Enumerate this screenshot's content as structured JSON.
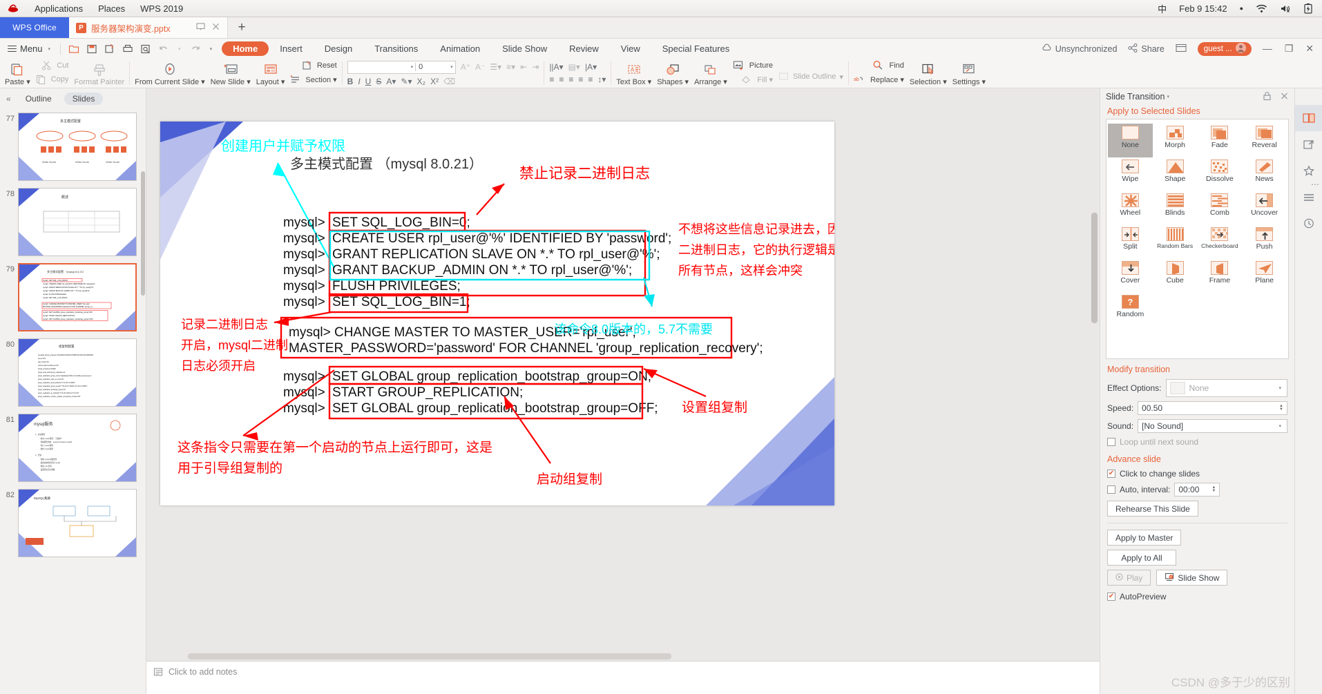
{
  "desktop": {
    "applications": "Applications",
    "places": "Places",
    "app_name": "WPS 2019",
    "input_method": "中",
    "clock": "Feb 9  15:42",
    "tray": [
      "wifi-icon",
      "volume-muted-icon",
      "battery-charging-icon"
    ]
  },
  "tabstrip": {
    "brand": "WPS Office",
    "document_tab": "服务器架构演变.pptx",
    "doc_icon": "P",
    "new_tab": "+",
    "window_controls": [
      "minimize",
      "restore",
      "close"
    ]
  },
  "ribbon": {
    "menu": "Menu",
    "quick_access": [
      "open-icon",
      "save-icon",
      "save-as-icon",
      "print-icon",
      "print-preview-icon",
      "undo-icon",
      "redo-icon",
      "customize-qat-icon"
    ],
    "tabs": [
      "Home",
      "Insert",
      "Design",
      "Transitions",
      "Animation",
      "Slide Show",
      "Review",
      "View",
      "Special Features"
    ],
    "active_tab": "Home",
    "sync_status": "Unsynchronized",
    "share": "Share",
    "account": "guest ...",
    "groups": {
      "clipboard": [
        "Paste",
        "Cut",
        "Copy",
        "Format Painter"
      ],
      "presentation": [
        "From Current Slide",
        "New Slide",
        "Layout",
        "Section",
        "Reset"
      ],
      "font_size_value": "0",
      "font_name_value": "",
      "text": [
        "Text Box",
        "Shapes",
        "Arrange",
        "Picture",
        "Fill",
        "Slide Outline"
      ],
      "editing": [
        "Find",
        "Replace",
        "Selection",
        "Settings"
      ]
    }
  },
  "leftpane": {
    "collapse_icon": "«",
    "tabs": [
      "Outline",
      "Slides"
    ],
    "active_tab": "Slides",
    "thumbnails": [
      {
        "number": "77",
        "title": "多主模式配置"
      },
      {
        "number": "78",
        "title": "概述"
      },
      {
        "number": "79",
        "title": "多主模式配置  mysql 8.0.21"
      },
      {
        "number": "80",
        "title": "组复制配置"
      },
      {
        "number": "81",
        "title": "mysql服务"
      },
      {
        "number": "82",
        "title": "MySQL集群"
      }
    ],
    "selected": "79"
  },
  "notes": {
    "placeholder": "Click to add notes",
    "icon": "notes-icon"
  },
  "slide": {
    "annotations": {
      "cyan_title": "创建用户并赋予权限",
      "heading": "多主模式配置 （mysql 8.0.21）",
      "red_top": "禁止记录二进制日志",
      "red_right_l1": "不想将这些信息记录进去，因为一旦记入",
      "red_right_l2": "二进制日志，它的执行逻辑是发送到其他",
      "red_right_l3": "所有节点，这样会冲突",
      "red_left_l1": "记录二进制日志",
      "red_left_l2": "开启，mysql二进制",
      "red_left_l3": "日志必须开启",
      "cyan_note": "该命令8.0版本的，5.7不需要",
      "red_setrep": "设置组复制",
      "red_bottom_l1": "这条指令只需要在第一个启动的节点上运行即可，这是",
      "red_bottom_l2": "用于引导组复制的",
      "red_startrep": "启动组复制"
    },
    "prompt": "mysql>",
    "commands": [
      "SET SQL_LOG_BIN=0;",
      "CREATE USER rpl_user@'%' IDENTIFIED BY 'password';",
      "GRANT REPLICATION SLAVE ON *.* TO rpl_user@'%';",
      "GRANT BACKUP_ADMIN ON *.* TO rpl_user@'%';",
      "FLUSH PRIVILEGES;",
      "SET SQL_LOG_BIN=1;"
    ],
    "change_master_l1": "mysql> CHANGE MASTER TO MASTER_USER='rpl_user',",
    "change_master_l2": "MASTER_PASSWORD='password' FOR CHANNEL 'group_replication_recovery';",
    "bootstrap_commands": [
      "SET GLOBAL group_replication_bootstrap_group=ON;",
      "START GROUP_REPLICATION;",
      "SET GLOBAL group_replication_bootstrap_group=OFF;"
    ],
    "colors": {
      "red": "#FF0000",
      "cyan": "#00FFFF",
      "blue_tri": "#4A5FD4",
      "lilac_tri": "#C9CDEE"
    }
  },
  "transition_panel": {
    "title": "Slide Transition",
    "lock_icon": "lock-icon",
    "close_icon": "close-icon",
    "apply_header": "Apply to Selected Slides",
    "effects": [
      "None",
      "Morph",
      "Fade",
      "Reveral",
      "Wipe",
      "Shape",
      "Dissolve",
      "News",
      "Wheel",
      "Blinds",
      "Comb",
      "Uncover",
      "Split",
      "Random Bars",
      "Checkerboard",
      "Push",
      "Cover",
      "Cube",
      "Frame",
      "Plane",
      "Random"
    ],
    "selected_effect": "None",
    "modify_header": "Modify transition",
    "effect_options_label": "Effect Options:",
    "effect_options_value": "None",
    "speed_label": "Speed:",
    "speed_value": "00.50",
    "sound_label": "Sound:",
    "sound_value": "[No Sound]",
    "loop_label": "Loop until next sound",
    "loop_checked": false,
    "advance_header": "Advance slide",
    "click_label": "Click to change slides",
    "click_checked": true,
    "auto_label": "Auto, interval:",
    "auto_checked": false,
    "auto_value": "00:00",
    "rehearse": "Rehearse This Slide",
    "apply_master": "Apply to Master",
    "apply_all": "Apply to All",
    "play": "Play",
    "slide_show": "Slide Show",
    "autopreview_label": "AutoPreview",
    "autopreview_checked": true,
    "watermark": "CSDN @多于少的区别"
  },
  "rail": {
    "items": [
      "slide-transition-icon",
      "export-icon",
      "animation-icon",
      "layers-icon",
      "history-icon"
    ],
    "active": "slide-transition-icon"
  }
}
